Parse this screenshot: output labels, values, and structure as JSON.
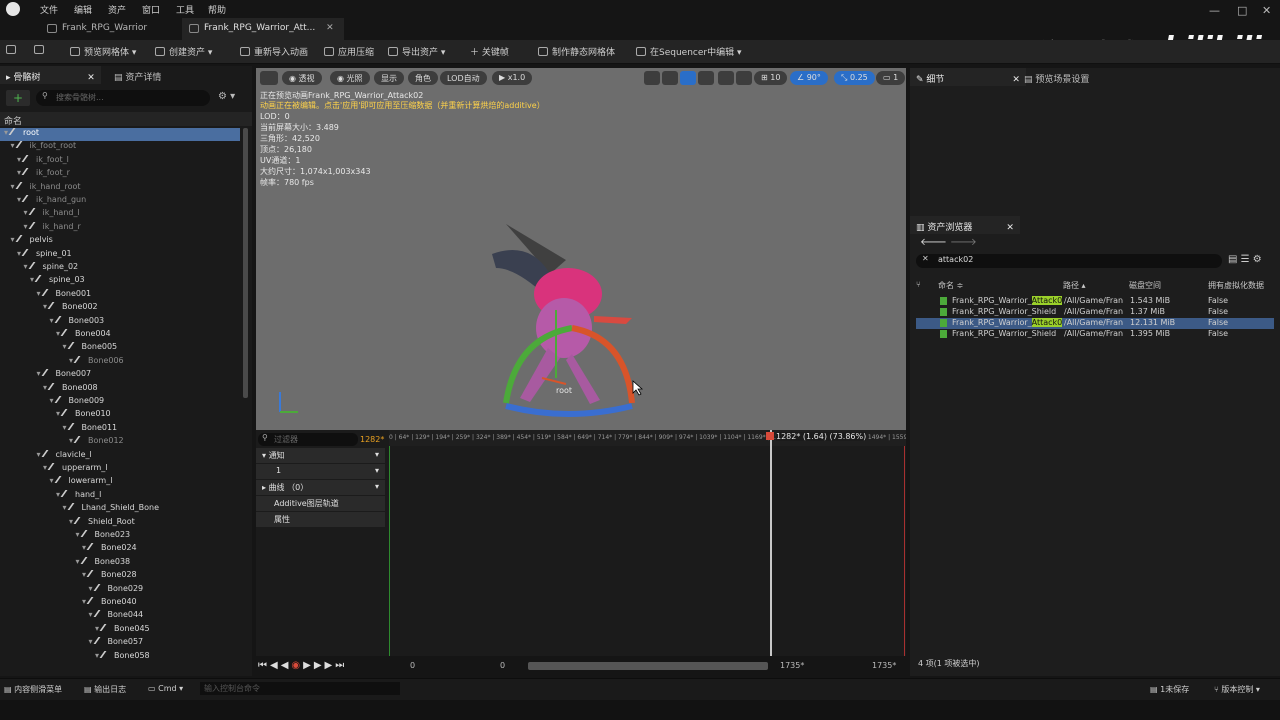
{
  "menubar": {
    "items": [
      "文件",
      "编辑",
      "资产",
      "窗口",
      "工具",
      "帮助"
    ]
  },
  "tabs": [
    {
      "label": "Frank_RPG_Warrior"
    },
    {
      "label": "Frank_RPG_Warrior_Att..."
    }
  ],
  "watermark": {
    "text": "乔治·周士诚",
    "site": "bilibili"
  },
  "toolbar": {
    "preview_mesh": "预览网格体",
    "create_asset": "创建资产",
    "reimport": "重新导入动画",
    "apply_compression": "应用压缩",
    "export_asset": "导出资产",
    "keyframe": "关键帧",
    "make_static_mesh": "制作静态网格体",
    "edit_in_sequencer": "在Sequencer中编辑"
  },
  "left_panel": {
    "tabs": [
      "骨骼树",
      "资产详情"
    ],
    "search_placeholder": "搜索骨骼树...",
    "column": "命名"
  },
  "bones": [
    {
      "name": "root",
      "depth": 0,
      "selected": true
    },
    {
      "name": "ik_foot_root",
      "depth": 1,
      "virtual": true
    },
    {
      "name": "ik_foot_l",
      "depth": 2,
      "virtual": true
    },
    {
      "name": "ik_foot_r",
      "depth": 2,
      "virtual": true
    },
    {
      "name": "ik_hand_root",
      "depth": 1,
      "virtual": true
    },
    {
      "name": "ik_hand_gun",
      "depth": 2,
      "virtual": true
    },
    {
      "name": "ik_hand_l",
      "depth": 3,
      "virtual": true
    },
    {
      "name": "ik_hand_r",
      "depth": 3,
      "virtual": true
    },
    {
      "name": "pelvis",
      "depth": 1
    },
    {
      "name": "spine_01",
      "depth": 2
    },
    {
      "name": "spine_02",
      "depth": 3
    },
    {
      "name": "spine_03",
      "depth": 4
    },
    {
      "name": "Bone001",
      "depth": 5
    },
    {
      "name": "Bone002",
      "depth": 6
    },
    {
      "name": "Bone003",
      "depth": 7
    },
    {
      "name": "Bone004",
      "depth": 8
    },
    {
      "name": "Bone005",
      "depth": 9
    },
    {
      "name": "Bone006",
      "depth": 10,
      "virtual": true
    },
    {
      "name": "Bone007",
      "depth": 5
    },
    {
      "name": "Bone008",
      "depth": 6
    },
    {
      "name": "Bone009",
      "depth": 7
    },
    {
      "name": "Bone010",
      "depth": 8
    },
    {
      "name": "Bone011",
      "depth": 9
    },
    {
      "name": "Bone012",
      "depth": 10,
      "virtual": true
    },
    {
      "name": "clavicle_l",
      "depth": 5
    },
    {
      "name": "upperarm_l",
      "depth": 6
    },
    {
      "name": "lowerarm_l",
      "depth": 7
    },
    {
      "name": "hand_l",
      "depth": 8
    },
    {
      "name": "Lhand_Shield_Bone",
      "depth": 9
    },
    {
      "name": "Shield_Root",
      "depth": 10
    },
    {
      "name": "Bone023",
      "depth": 11
    },
    {
      "name": "Bone024",
      "depth": 12
    },
    {
      "name": "Bone038",
      "depth": 11
    },
    {
      "name": "Bone028",
      "depth": 12
    },
    {
      "name": "Bone029",
      "depth": 13
    },
    {
      "name": "Bone040",
      "depth": 12
    },
    {
      "name": "Bone044",
      "depth": 13
    },
    {
      "name": "Bone045",
      "depth": 14
    },
    {
      "name": "Bone057",
      "depth": 13
    },
    {
      "name": "Bone058",
      "depth": 14
    }
  ],
  "viewport": {
    "buttons": [
      "透视",
      "光照",
      "显示",
      "角色",
      "LOD自动",
      "x1.0"
    ],
    "icon_values": [
      "10",
      "90°",
      "0.25",
      "1"
    ],
    "info_lines": [
      {
        "text": "正在预览动画Frank_RPG_Warrior_Attack02",
        "color": "white"
      },
      {
        "text": "动画正在被编辑。点击'应用'即可应用至压缩数据（并重新计算烘焙的additive）",
        "color": "yellow"
      },
      {
        "text": "LOD：0",
        "color": "white"
      },
      {
        "text": "当前屏幕大小：3.489",
        "color": "white"
      },
      {
        "text": "三角形：42,520",
        "color": "white"
      },
      {
        "text": "顶点：26,180",
        "color": "white"
      },
      {
        "text": "UV通道：1",
        "color": "white"
      },
      {
        "text": "大约尺寸：1,074x1,003x343",
        "color": "white"
      },
      {
        "text": "帧率：780 fps",
        "color": "white"
      }
    ],
    "root_label": "root"
  },
  "sequencer": {
    "filter_placeholder": "过滤器",
    "current_frame": "1282*",
    "playhead_label": "1282* (1.64) (73.86%)",
    "tracks": [
      "通知",
      "1",
      "曲线 （0）",
      "Additive图层轨道",
      "属性"
    ],
    "ruler": "0 | 64* | 129* | 194* | 259* | 324* | 389* | 454* | 519* | 584* | 649* | 714* | 779* | 844* | 909* | 974* | 1039* | 1104* | 1169* | 1234* | 1299* | 1364* | 1429* | 1494* | 1559* | 1624* | 168",
    "range_start": "0",
    "range_start2": "0",
    "range_end": "1735*",
    "range_end2": "1735*"
  },
  "right_panel": {
    "tabs": [
      "细节",
      "预览场景设置"
    ]
  },
  "content_browser": {
    "tab": "资产浏览器",
    "search": "attack02",
    "columns": [
      "命名",
      "路径",
      "磁盘空间",
      "拥有虚拟化数据"
    ],
    "rows": [
      {
        "name_prefix": "Frank_RPG_Warrior_",
        "name_hl": "Attack0",
        "path": "/All/Game/Fran",
        "size": "1.543 MiB",
        "virt": "False",
        "selected": false
      },
      {
        "name_prefix": "Frank_RPG_Warrior_Shield",
        "name_hl": "",
        "path": "/All/Game/Fran",
        "size": "1.37 MiB",
        "virt": "False",
        "selected": false
      },
      {
        "name_prefix": "Frank_RPG_Warrior_",
        "name_hl": "Attack0",
        "path": "/All/Game/Fran",
        "size": "12.131 MiB",
        "virt": "False",
        "selected": true
      },
      {
        "name_prefix": "Frank_RPG_Warrior_Shield",
        "name_hl": "",
        "path": "/All/Game/Fran",
        "size": "1.395 MiB",
        "virt": "False",
        "selected": false
      }
    ],
    "footer": "4 项(1 项被选中)"
  },
  "statusbar": {
    "content_drawer": "内容侧滑菜单",
    "output_log": "输出日志",
    "cmd": "Cmd",
    "console_placeholder": "输入控制台命令",
    "unsaved": "1未保存",
    "source_control": "版本控制"
  }
}
